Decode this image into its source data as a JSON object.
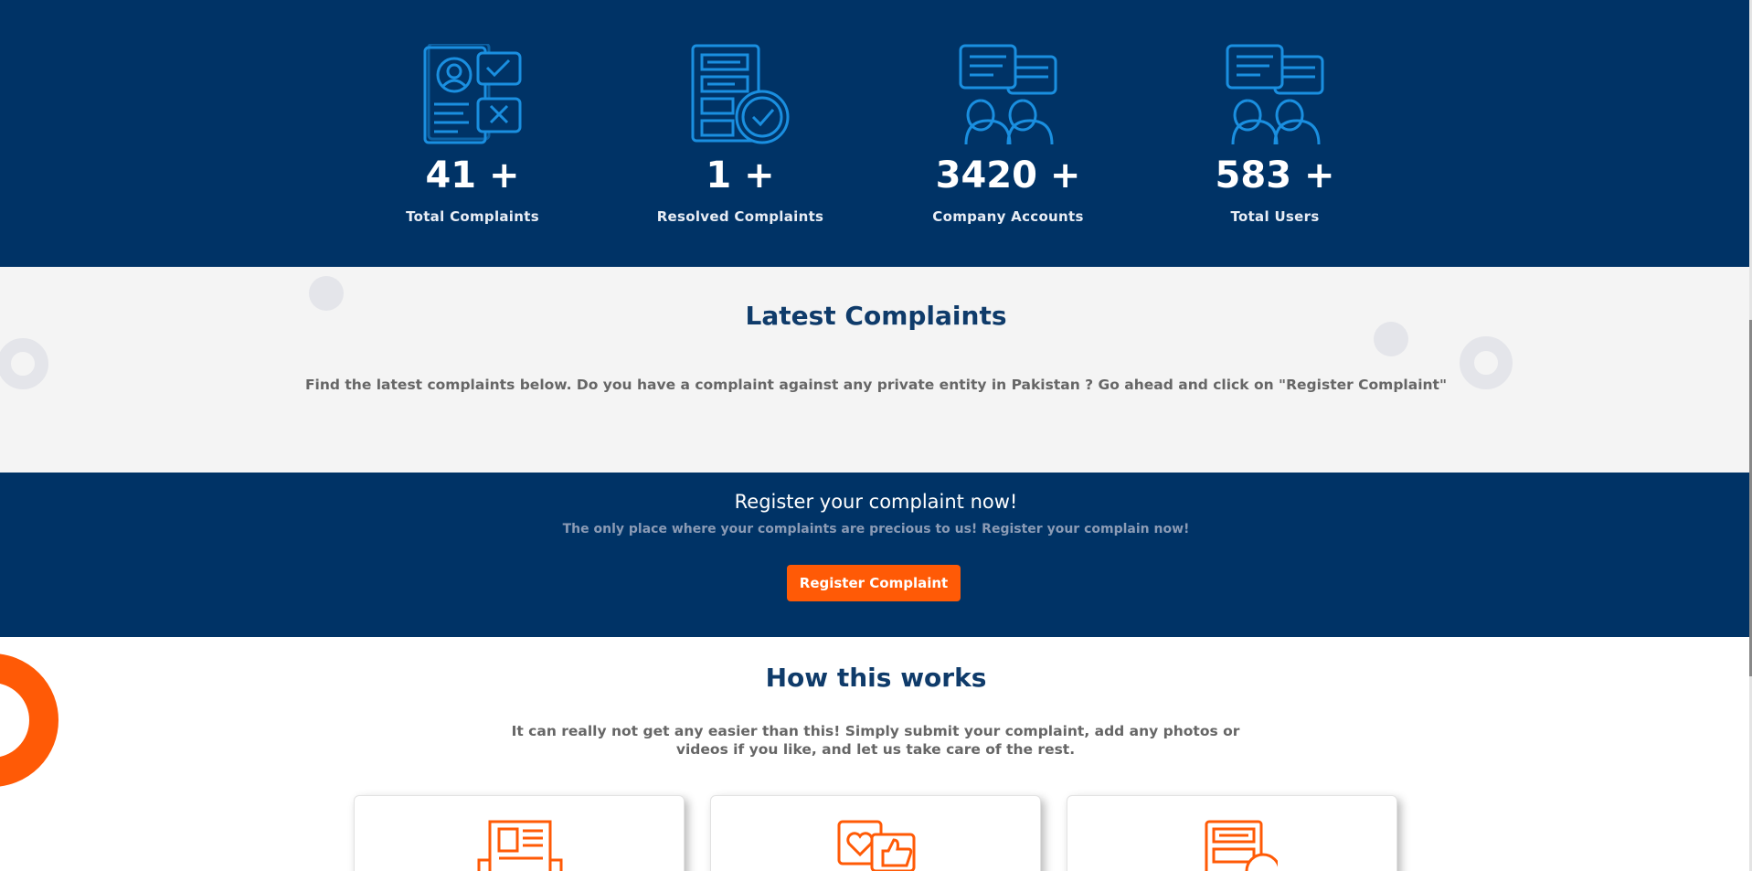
{
  "stats": [
    {
      "value": "41 +",
      "label": "Total Complaints",
      "icon": "complaint-form-icon"
    },
    {
      "value": "1 +",
      "label": "Resolved Complaints",
      "icon": "resolved-document-icon"
    },
    {
      "value": "3420 +",
      "label": "Company Accounts",
      "icon": "company-chat-users-icon"
    },
    {
      "value": "583 +",
      "label": "Total Users",
      "icon": "users-chat-icon"
    }
  ],
  "latest": {
    "title": "Latest Complaints",
    "description": "Find the latest complaints below. Do you have a complaint against any private entity in Pakistan ? Go ahead and click on \"Register Complaint\""
  },
  "register": {
    "title": "Register your complaint now!",
    "subtitle": "The only place where your complaints are precious to us! Register your complain now!",
    "button_label": "Register Complaint"
  },
  "how": {
    "title": "How this works",
    "description": "It can really not get any easier than this! Simply submit your complaint, add any photos or videos if you like, and let us take care of the rest.",
    "cards": [
      {
        "icon": "newspaper-icon"
      },
      {
        "icon": "social-likes-icon"
      },
      {
        "icon": "form-check-icon"
      }
    ]
  },
  "colors": {
    "navy": "#003366",
    "icon_blue": "#1a8fe0",
    "heading": "#0f3b6a",
    "accent_orange": "#ff5a06",
    "light_bg": "#f4f4f4"
  }
}
